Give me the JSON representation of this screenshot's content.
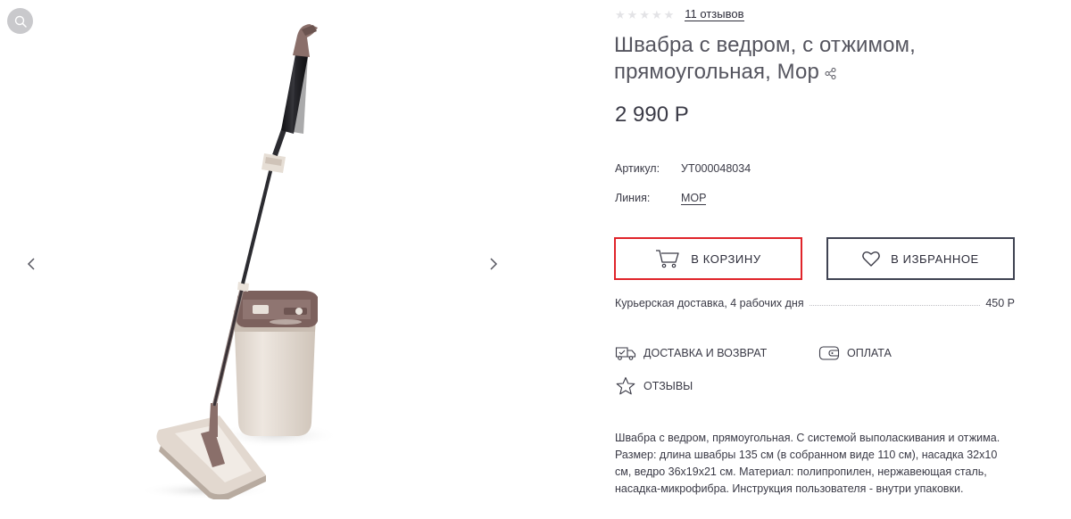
{
  "gallery": {
    "zoom_icon": "magnifier-icon",
    "prev_icon": "chevron-left-icon",
    "next_icon": "chevron-right-icon"
  },
  "rating": {
    "stars_filled": 0,
    "stars_total": 5,
    "reviews_text": "11 отзывов"
  },
  "product": {
    "title": "Швабра с ведром, с отжимом, прямоугольная, Мор",
    "price": "2 990 Р",
    "props": [
      {
        "key": "Артикул:",
        "value": "УТ000048034"
      },
      {
        "key": "Линия:",
        "value": "МОР"
      }
    ],
    "description": "Швабра с ведром, прямоугольная. С системой выполаскивания и отжима. Размер: длина швабры 135 см (в собранном виде 110 см), насадка 32x10 см, ведро 36x19x21 см. Материал: полипропилен, нержавеющая сталь, насадка-микрофибра. Инструкция пользователя - внутри упаковки."
  },
  "actions": {
    "cart_label": "В КОРЗИНУ",
    "favorite_label": "В ИЗБРАННОЕ"
  },
  "delivery": {
    "label": "Курьерская доставка, 4 рабочих дня",
    "price": "450 Р"
  },
  "info_links": {
    "delivery_return": "ДОСТАВКА И ВОЗВРАТ",
    "payment": "ОПЛАТА",
    "reviews": "ОТЗЫВЫ"
  },
  "colors": {
    "cart_border": "#e0242a",
    "fav_border": "#3f4352",
    "text": "#3a3a46",
    "mop_handle": "#1e1e22",
    "mop_accent": "#8a6f6a",
    "bucket": "#e4dcd4"
  }
}
